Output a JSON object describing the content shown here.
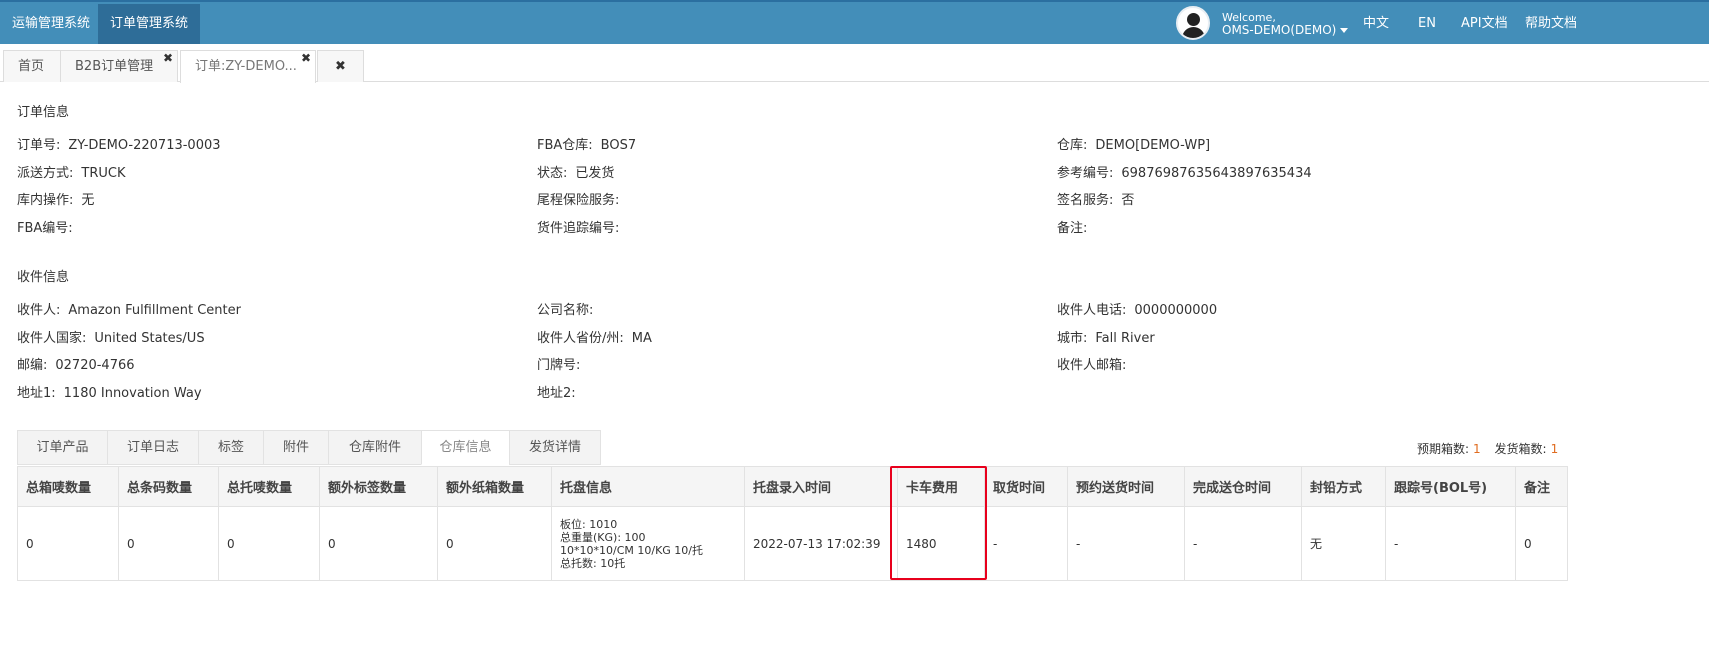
{
  "topbar": {
    "systems": [
      "运输管理系统",
      "订单管理系统"
    ],
    "welcome": "Welcome,",
    "username": "OMS-DEMO(DEMO)",
    "links": [
      "中文",
      "EN",
      "API文档",
      "帮助文档"
    ]
  },
  "page_tabs": [
    "首页",
    "B2B订单管理",
    "订单:ZY-DEMO..."
  ],
  "order_info": {
    "title": "订单信息",
    "fields": [
      {
        "label": "订单号:",
        "value": "ZY-DEMO-220713-0003"
      },
      {
        "label": "FBA仓库:",
        "value": "BOS7"
      },
      {
        "label": "仓库:",
        "value": "DEMO[DEMO-WP]"
      },
      {
        "label": "派送方式:",
        "value": "TRUCK"
      },
      {
        "label": "状态:",
        "value": "已发货"
      },
      {
        "label": "参考编号:",
        "value": "69876987635643897635434"
      },
      {
        "label": "库内操作:",
        "value": "无"
      },
      {
        "label": "尾程保险服务:",
        "value": ""
      },
      {
        "label": "签名服务:",
        "value": "否"
      },
      {
        "label": "FBA编号:",
        "value": ""
      },
      {
        "label": "货件追踪编号:",
        "value": ""
      },
      {
        "label": "备注:",
        "value": ""
      }
    ]
  },
  "receiver_info": {
    "title": "收件信息",
    "fields": [
      {
        "label": "收件人:",
        "value": "Amazon Fulfillment Center"
      },
      {
        "label": "公司名称:",
        "value": ""
      },
      {
        "label": "收件人电话:",
        "value": "0000000000"
      },
      {
        "label": "收件人国家:",
        "value": "United States/US"
      },
      {
        "label": "收件人省份/州:",
        "value": "MA"
      },
      {
        "label": "城市:",
        "value": "Fall River"
      },
      {
        "label": "邮编:",
        "value": "02720-4766"
      },
      {
        "label": "门牌号:",
        "value": ""
      },
      {
        "label": "收件人邮箱:",
        "value": ""
      },
      {
        "label": "地址1:",
        "value": "1180 Innovation Way"
      },
      {
        "label": "地址2:",
        "value": ""
      }
    ]
  },
  "detail_tabs": [
    "订单产品",
    "订单日志",
    "标签",
    "附件",
    "仓库附件",
    "仓库信息",
    "发货详情"
  ],
  "counts": {
    "expected_label": "预期箱数:",
    "expected_value": "1",
    "shipped_label": "发货箱数:",
    "shipped_value": "1"
  },
  "table": {
    "headers": [
      "总箱唛数量",
      "总条码数量",
      "总托唛数量",
      "额外标签数量",
      "额外纸箱数量",
      "托盘信息",
      "托盘录入时间",
      "卡车费用",
      "取货时间",
      "预约送货时间",
      "完成送仓时间",
      "封铅方式",
      "跟踪号(BOL号)",
      "备注"
    ],
    "row": {
      "c0": "0",
      "c1": "0",
      "c2": "0",
      "c3": "0",
      "c4": "0",
      "pallet": [
        "板位: 1010",
        "总重量(KG): 100",
        "10*10*10/CM 10/KG 10/托",
        "总托数: 10托"
      ],
      "c6": "2022-07-13 17:02:39",
      "c7": "1480",
      "c8": "-",
      "c9": "-",
      "c10": "-",
      "c11": "无",
      "c12": "-",
      "c13": "0"
    }
  },
  "colors": {
    "topbar": "#438eb9",
    "highlight": "#e8001c",
    "count_number": "#e06c20"
  }
}
